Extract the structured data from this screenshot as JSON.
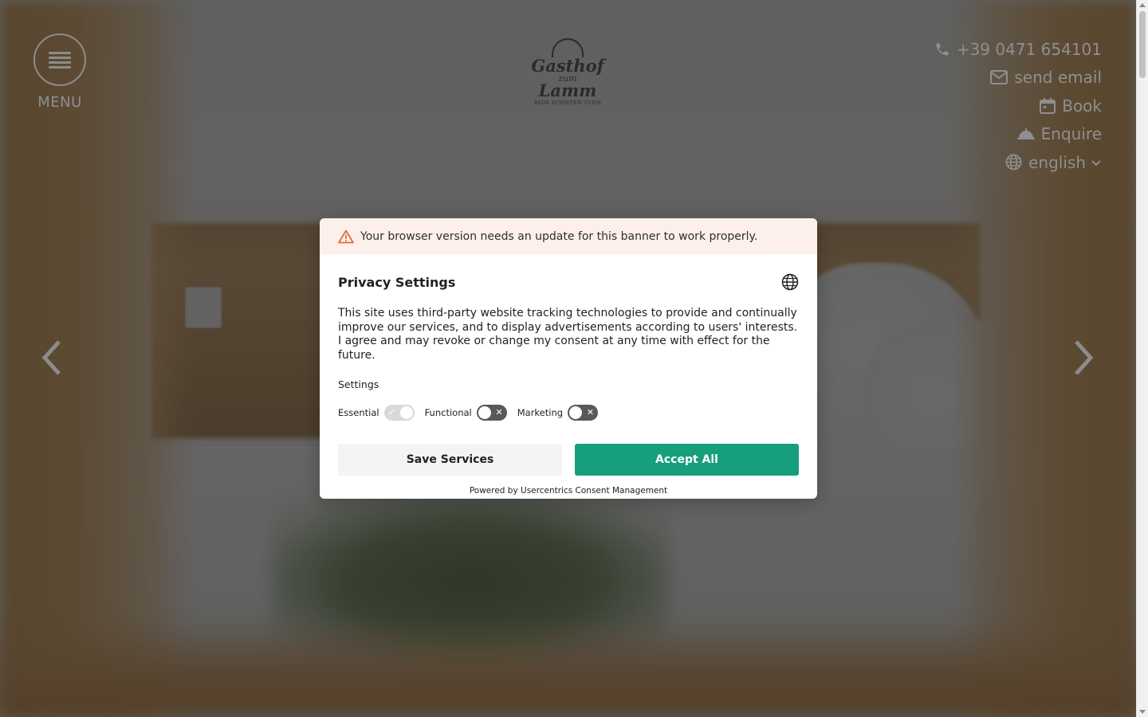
{
  "header": {
    "menu_label": "MENU",
    "logo": {
      "line1": "Gasthof",
      "line2": "zum",
      "line3": "Lamm",
      "line4": "BEIM SCHIEFEN TURM"
    },
    "contact": {
      "phone": "+39 0471 654101",
      "email": "send email",
      "book": "Book",
      "enquire": "Enquire",
      "language": "english"
    }
  },
  "consent": {
    "warning": "Your browser version needs an update for this banner to work properly.",
    "title": "Privacy Settings",
    "description": "This site uses third-party website tracking technologies to provide and continually improve our services, and to display advertisements according to users' interests. I agree and may revoke or change my consent at any time with effect for the future.",
    "settings_label": "Settings",
    "toggles": [
      {
        "label": "Essential",
        "state": "on",
        "disabled": true
      },
      {
        "label": "Functional",
        "state": "off",
        "disabled": false
      },
      {
        "label": "Marketing",
        "state": "off",
        "disabled": false
      }
    ],
    "save_label": "Save Services",
    "accept_label": "Accept All",
    "powered_by": "Powered by Usercentrics Consent Management"
  },
  "colors": {
    "accent": "#169e7d",
    "warning_bg": "#fdf0ea",
    "warning_icon": "#e06b3a"
  },
  "icons": {
    "menu": "hamburger-icon",
    "phone": "phone-icon",
    "email": "mail-icon",
    "book": "calendar-icon",
    "enquire": "cloche-icon",
    "language": "globe-icon",
    "prev": "chevron-left-icon",
    "next": "chevron-right-icon"
  }
}
